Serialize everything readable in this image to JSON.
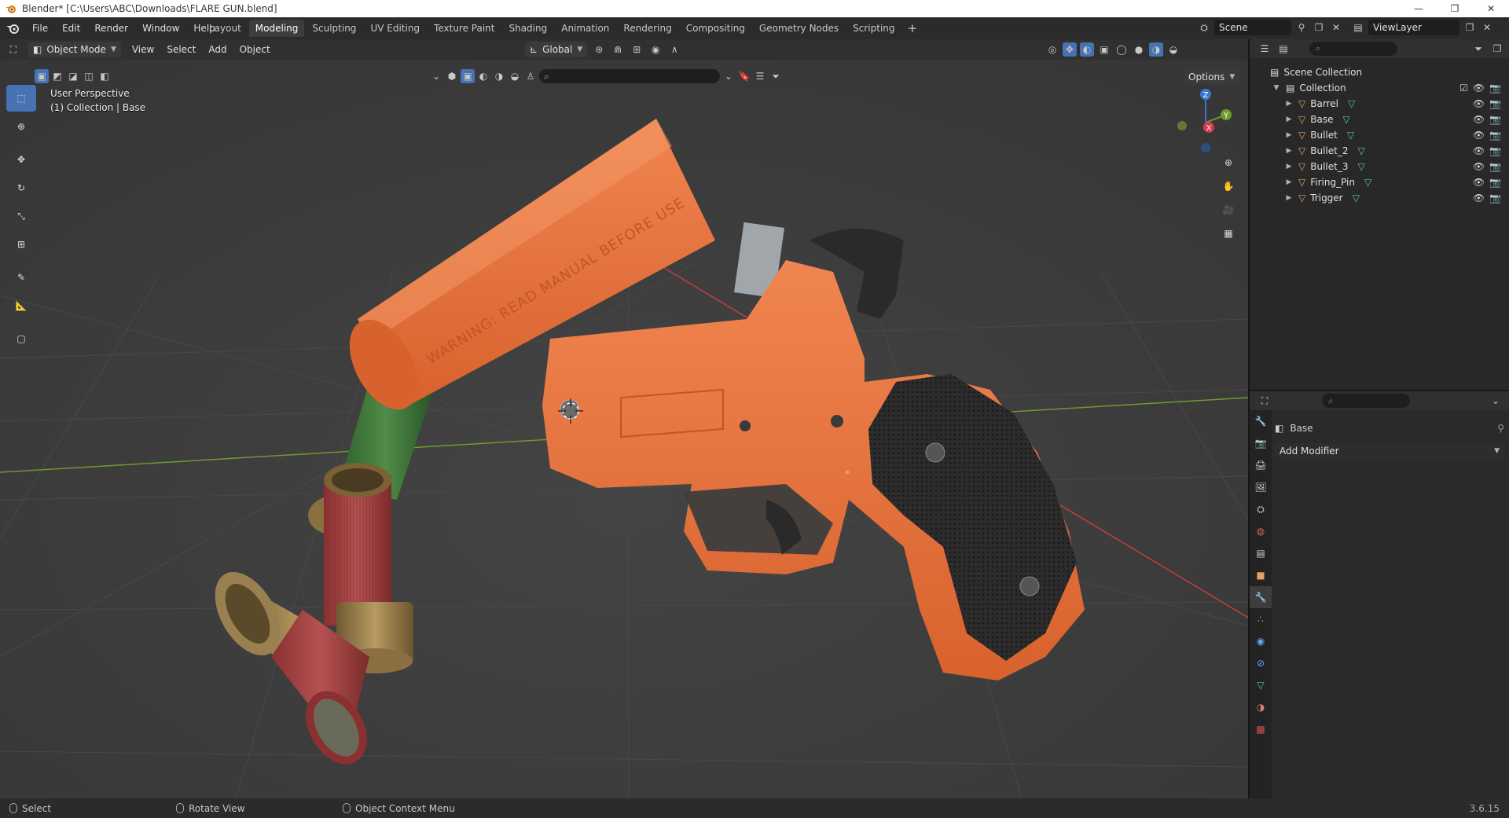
{
  "window": {
    "title": "Blender* [C:\\Users\\ABC\\Downloads\\FLARE GUN.blend]",
    "controls": [
      "—",
      "❐",
      "✕"
    ]
  },
  "menu": {
    "items": [
      "File",
      "Edit",
      "Render",
      "Window",
      "Help"
    ]
  },
  "workspaces": {
    "tabs": [
      "Layout",
      "Modeling",
      "Sculpting",
      "UV Editing",
      "Texture Paint",
      "Shading",
      "Animation",
      "Rendering",
      "Compositing",
      "Geometry Nodes",
      "Scripting"
    ],
    "active": "Modeling",
    "add": "+"
  },
  "scene": {
    "name": "Scene",
    "view_layer": "ViewLayer"
  },
  "viewport_header": {
    "mode": "Object Mode",
    "menus": [
      "View",
      "Select",
      "Add",
      "Object"
    ],
    "orientation": "Global",
    "options": "Options"
  },
  "viewport": {
    "info_line1": "User Perspective",
    "info_line2": "(1) Collection | Base",
    "barrel_text": "WARNING: READ MANUAL BEFORE USE",
    "axes": {
      "x": "X",
      "y": "Y",
      "z": "Z"
    },
    "colors": {
      "background": "#3d3d3d",
      "gun_orange": "#e8743f",
      "grip_black": "#2a2a2a",
      "shell_red": "#a84848",
      "shell_green": "#3e7a3a",
      "brass": "#a88a55",
      "x_axis": "#c04040",
      "y_axis": "#6e9a30"
    }
  },
  "outliner": {
    "root": "Scene Collection",
    "collection": "Collection",
    "objects": [
      "Barrel",
      "Base",
      "Bullet",
      "Bullet_2",
      "Bullet_3",
      "Firing_Pin",
      "Trigger"
    ],
    "selected": "Base"
  },
  "properties": {
    "object_name": "Base",
    "add_modifier": "Add Modifier"
  },
  "statusbar": {
    "select": "Select",
    "rotate": "Rotate View",
    "context_menu": "Object Context Menu",
    "version": "3.6.15"
  }
}
